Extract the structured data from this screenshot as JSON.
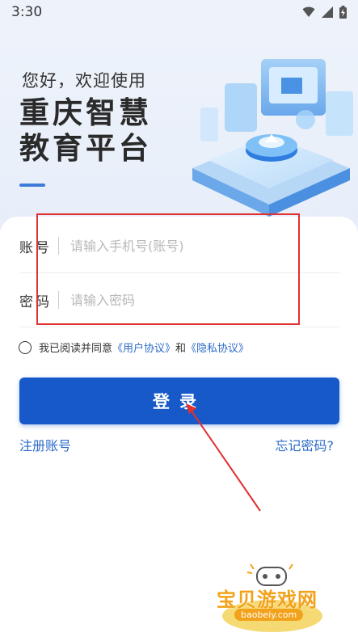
{
  "status_bar": {
    "time": "3:30"
  },
  "hero": {
    "greeting": "您好，欢迎使用",
    "title_line1": "重庆智慧",
    "title_line2": "教育平台"
  },
  "form": {
    "account": {
      "label": "账号",
      "placeholder": "请输入手机号(账号)",
      "value": ""
    },
    "password": {
      "label": "密码",
      "placeholder": "请输入密码",
      "value": ""
    }
  },
  "agreement": {
    "checked": false,
    "prefix": "我已阅读并同意",
    "user_agreement": "《用户协议》",
    "conjunction": "和",
    "privacy_agreement": "《隐私协议》"
  },
  "actions": {
    "login_label": "登录",
    "register_label": "注册账号",
    "forgot_label": "忘记密码?"
  },
  "watermark": {
    "text": "宝贝游戏网",
    "url": "baobeiy.com"
  },
  "colors": {
    "primary": "#1759c8",
    "link": "#2c6bc9",
    "annotation": "#e03030",
    "watermark": "#f2a21a"
  }
}
